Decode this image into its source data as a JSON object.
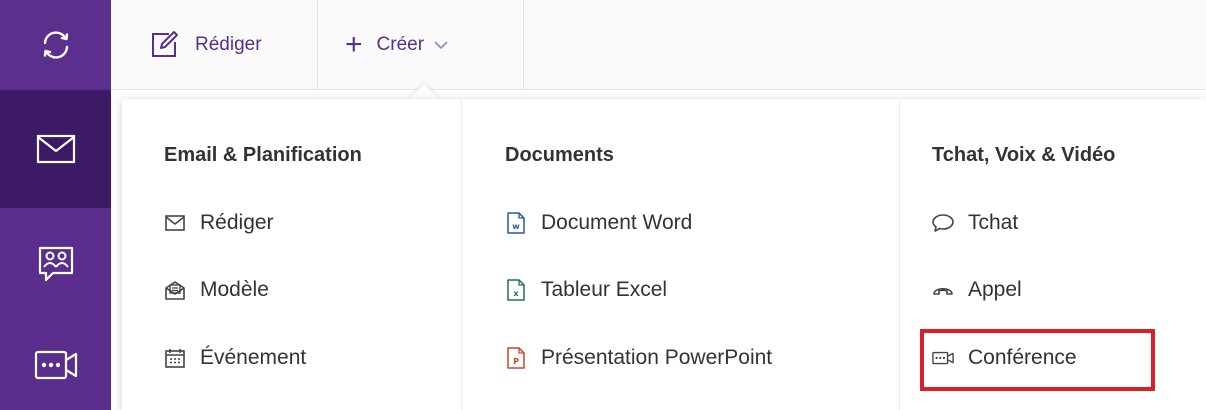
{
  "rail": {
    "items": [
      {
        "icon": "sync-icon"
      },
      {
        "icon": "mail-icon"
      },
      {
        "icon": "contacts-icon"
      },
      {
        "icon": "video-conference-icon"
      }
    ],
    "colors": {
      "rail": "#5a2e8c",
      "active": "#3d1a66"
    }
  },
  "toolbar": {
    "compose_label": "Rédiger",
    "create_label": "Créer"
  },
  "menu": {
    "columns": [
      {
        "title": "Email & Planification",
        "items": [
          {
            "label": "Rédiger",
            "icon": "envelope-icon"
          },
          {
            "label": "Modèle",
            "icon": "template-icon"
          },
          {
            "label": "Événement",
            "icon": "calendar-icon"
          }
        ]
      },
      {
        "title": "Documents",
        "items": [
          {
            "label": "Document Word",
            "icon": "word-doc-icon"
          },
          {
            "label": "Tableur Excel",
            "icon": "excel-sheet-icon"
          },
          {
            "label": "Présentation PowerPoint",
            "icon": "powerpoint-icon"
          }
        ]
      },
      {
        "title": "Tchat, Voix & Vidéo",
        "items": [
          {
            "label": "Tchat",
            "icon": "chat-icon"
          },
          {
            "label": "Appel",
            "icon": "phone-icon"
          },
          {
            "label": "Conférence",
            "icon": "video-icon"
          }
        ]
      }
    ]
  },
  "highlight_color": "#d6202a"
}
